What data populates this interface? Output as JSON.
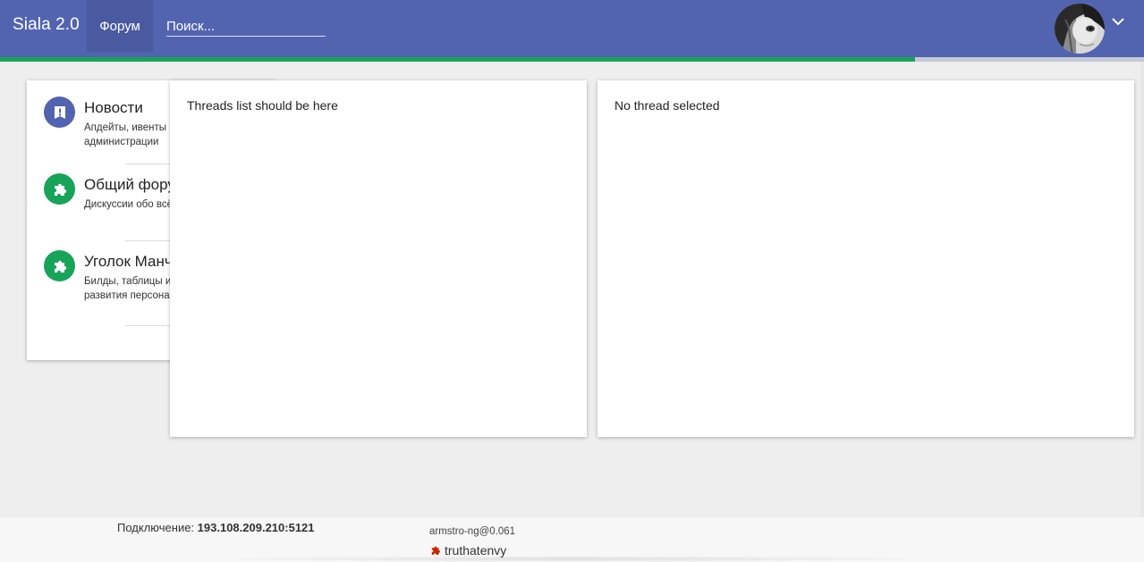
{
  "appbar": {
    "brand": "Siala 2.0",
    "nav_forum": "Форум",
    "search_placeholder": "Поиск...",
    "color": "#5264b0"
  },
  "progress": {
    "fraction": 0.8,
    "color": "#17a458"
  },
  "forums": [
    {
      "title": "Новости",
      "description": "Апдейты, ивенты и новости от администрации",
      "icon": "announcement-icon",
      "icon_color": "#5264b0"
    },
    {
      "title": "Общий форум",
      "description": "Дискуссии обо всём. Флуд запрещен.",
      "icon": "puzzle-icon",
      "icon_color": "#17a458"
    },
    {
      "title": "Уголок Манчкина",
      "description": "Билды, таблицы и стратегии развития персонажа.",
      "icon": "puzzle-icon",
      "icon_color": "#17a458"
    }
  ],
  "threads": {
    "placeholder": "Threads list should be here"
  },
  "thread_view": {
    "placeholder": "No thread selected"
  },
  "footer": {
    "connection_label": "Подключение:",
    "connection_value": "193.108.209.210:5121",
    "version": "armstro-ng@0.061",
    "username": "truthatenvy",
    "user_icon": "puzzle-icon",
    "user_icon_color": "#cc2200"
  }
}
